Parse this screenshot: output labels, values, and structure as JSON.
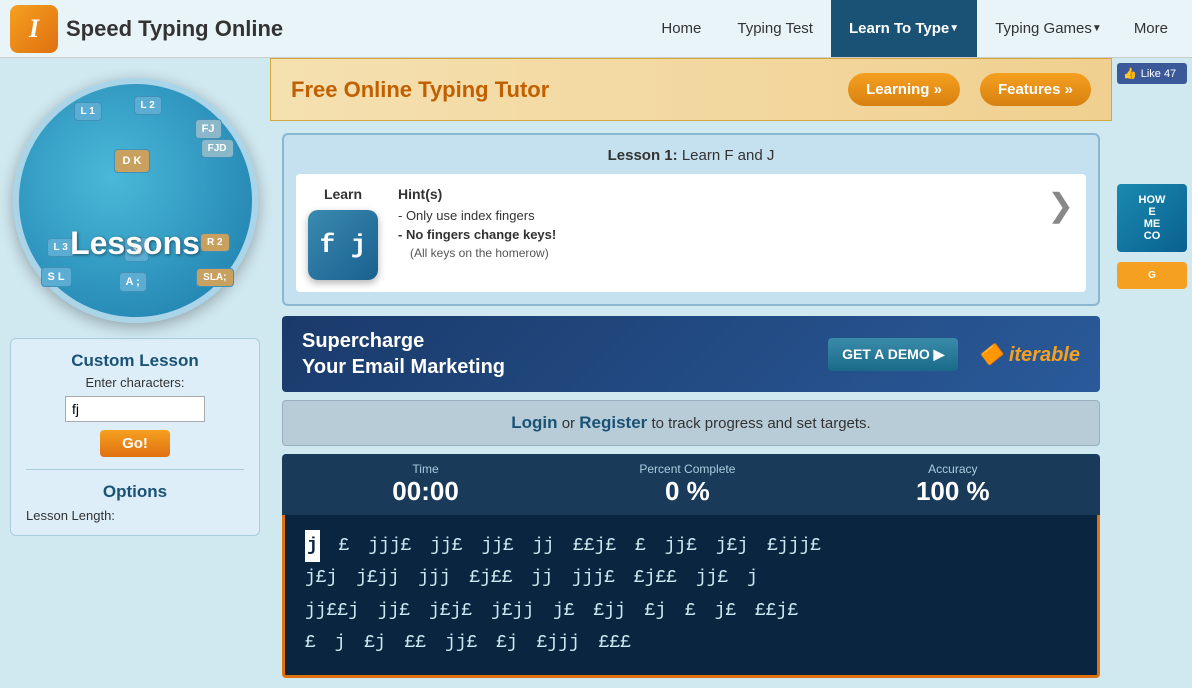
{
  "header": {
    "logo_text": "Speed Typing Online",
    "logo_icon": "I",
    "nav": [
      {
        "label": "Home",
        "active": false,
        "has_arrow": false
      },
      {
        "label": "Typing Test",
        "active": false,
        "has_arrow": false
      },
      {
        "label": "Learn To Type",
        "active": true,
        "has_arrow": true
      },
      {
        "label": "Typing Games",
        "active": false,
        "has_arrow": true
      },
      {
        "label": "More",
        "active": false,
        "has_arrow": false
      }
    ]
  },
  "banner": {
    "title": "Free Online Typing Tutor",
    "learning_btn": "Learning »",
    "features_btn": "Features »"
  },
  "lessons_circle": {
    "label": "Lessons",
    "tiles": [
      {
        "id": "l1",
        "text": "L 1"
      },
      {
        "id": "l2",
        "text": "L 2"
      },
      {
        "id": "fj",
        "text": "FJ"
      },
      {
        "id": "dk",
        "text": "D K"
      },
      {
        "id": "fjd",
        "text": "FJD"
      },
      {
        "id": "l3",
        "text": "L 3"
      },
      {
        "id": "r2",
        "text": "R 2"
      },
      {
        "id": "sl",
        "text": "S L"
      },
      {
        "id": "a_semi",
        "text": "A ;"
      },
      {
        "id": "sla",
        "text": "SLA;"
      }
    ]
  },
  "lesson_card": {
    "header": "Lesson 1: Learn F and J",
    "lesson_number": "Lesson 1:",
    "lesson_title": "Learn F and J",
    "learn_label": "Learn",
    "key_display": "f j",
    "hints_label": "Hint(s)",
    "hints": [
      "- Only use index fingers",
      "- No fingers change keys!",
      "(All keys on the homerow)"
    ]
  },
  "custom_lesson": {
    "title": "Custom Lesson",
    "enter_label": "Enter characters:",
    "input_value": "fj",
    "go_button": "Go!",
    "options_title": "Options",
    "lesson_length_label": "Lesson Length:"
  },
  "stats": {
    "time_label": "Time",
    "time_value": "00:00",
    "percent_label": "Percent Complete",
    "percent_value": "0 %",
    "accuracy_label": "Accuracy",
    "accuracy_value": "100 %"
  },
  "typing_area": {
    "cursor_char": "j",
    "text_line1": "  £  jjj£  jj£  jj£  jj  ££j£  £  jj£  j£j  £jjj£",
    "text_line2": "j£j  j£jj  jjj  £j££  jj  jjj£  £j££  jj£  j",
    "text_line3": "jj££j  jj£  j£j£  j£jj  j£  £jj  £j  £  j£  ££j£",
    "text_line4": "£  j  £j  ££  jj£  £j  £jjj  £££"
  },
  "login_bar": {
    "login_text": "Login",
    "or_text": " or ",
    "register_text": "Register",
    "suffix": " to track progress and set targets."
  },
  "ad_banner": {
    "text_line1": "Supercharge",
    "text_line2": "Your Email Marketing",
    "cta_btn": "GET A DEMO ▶",
    "logo_text": "iterable"
  },
  "right_sidebar": {
    "like_text": "Like 47",
    "ad_text": "HOW E ME CO",
    "cta_text": "G"
  },
  "colors": {
    "accent_orange": "#e07010",
    "nav_active": "#1a5276",
    "dark_blue": "#0a2540"
  }
}
